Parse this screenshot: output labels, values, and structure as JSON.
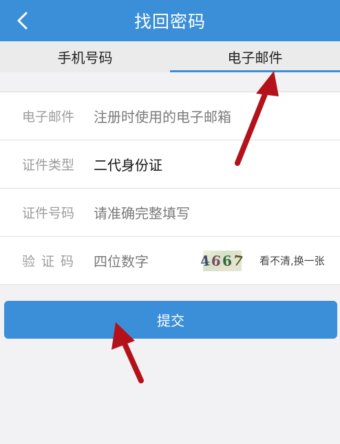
{
  "header": {
    "title": "找回密码",
    "back_icon": "chevron-left-icon"
  },
  "tabs": [
    {
      "label": "手机号码",
      "active": false
    },
    {
      "label": "电子邮件",
      "active": true
    }
  ],
  "form": {
    "email": {
      "label": "电子邮件",
      "placeholder": "注册时使用的电子邮箱"
    },
    "id_type": {
      "label": "证件类型",
      "value": "二代身份证"
    },
    "id_number": {
      "label": "证件号码",
      "placeholder": "请准确完整填写"
    },
    "captcha": {
      "label": "验证码",
      "placeholder": "四位数字",
      "image_text": "4667",
      "refresh_label": "看不清,换一张"
    }
  },
  "submit": {
    "label": "提交"
  },
  "colors": {
    "brand": "#3a8fd8",
    "annotation_arrow": "#b3121a"
  }
}
